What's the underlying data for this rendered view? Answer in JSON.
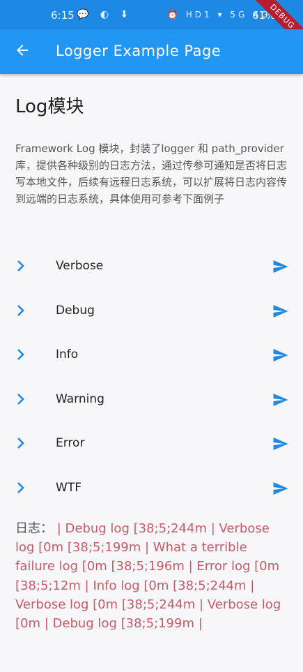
{
  "status_bar": {
    "time": "6:15",
    "left_icons": "💬 ◐ ⬇",
    "right_icons": "⏰ HD1 ▾ 5G 4G",
    "battery": "61%"
  },
  "debug_banner": "DEBUG",
  "app_bar": {
    "title": "Logger Example Page"
  },
  "heading": "Log模块",
  "description": "Framework Log 模块，封装了logger 和 path_provider 库，提供各种级别的日志方法，通过传参可通知是否将日志写本地文件，后续有远程日志系统，可以扩展将日志内容传到远端的日志系统，具体使用可参考下面例子",
  "levels": [
    {
      "label": "Verbose"
    },
    {
      "label": "Debug"
    },
    {
      "label": "Info"
    },
    {
      "label": "Warning"
    },
    {
      "label": "Error"
    },
    {
      "label": "WTF"
    }
  ],
  "log": {
    "label": "日志：",
    "text": " | Debug log  [38;5;244m | Verbose log  [0m  [38;5;199m | What a terrible failure log  [0m  [38;5;196m | Error log  [0m  [38;5;12m | Info log  [0m  [38;5;244m | Verbose log  [0m  [38;5;244m | Verbose log  [0m | Debug log  [38;5;199m |"
  },
  "colors": {
    "primary": "#2196f3",
    "status": "#1e88e5",
    "accent": "#1e88e5",
    "log": "#c75b66"
  }
}
